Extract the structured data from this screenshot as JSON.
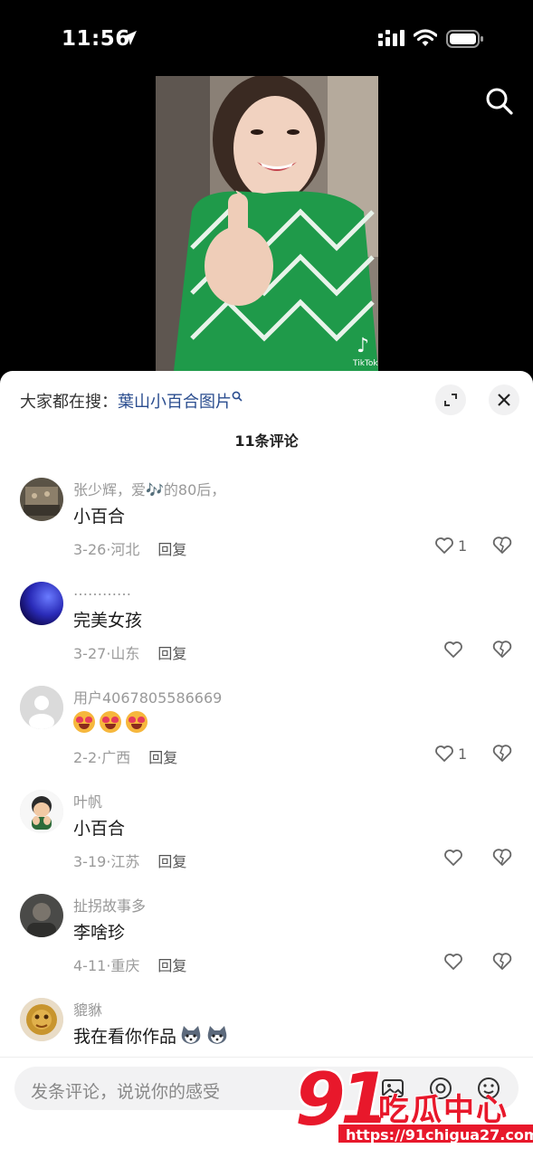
{
  "status_bar": {
    "time": "11:56"
  },
  "hot_search": {
    "prefix": "大家都在搜：",
    "query": "葉山小百合图片"
  },
  "comment_count": "11条评论",
  "comments": [
    {
      "user": "张少辉，爱🎶的80后，",
      "text": "小百合",
      "date_loc": "3-26·河北",
      "reply": "回复",
      "likes": "1"
    },
    {
      "user": "…………",
      "text": "完美女孩",
      "date_loc": "3-27·山东",
      "reply": "回复",
      "likes": ""
    },
    {
      "user": "用户4067805586669",
      "text": "",
      "date_loc": "2-2·广西",
      "reply": "回复",
      "likes": "1"
    },
    {
      "user": "叶帆",
      "text": "小百合",
      "date_loc": "3-19·江苏",
      "reply": "回复",
      "likes": ""
    },
    {
      "user": "扯拐故事多",
      "text": "李啥珍",
      "date_loc": "4-11·重庆",
      "reply": "回复",
      "likes": ""
    },
    {
      "user": "貔貅",
      "text": "我在看你作品",
      "date_loc": "",
      "reply": "",
      "likes": ""
    }
  ],
  "input": {
    "placeholder": "发条评论，说说你的感受"
  },
  "watermark": {
    "number": "91",
    "brand": "吃瓜中心",
    "url": "https://91chigua27.com"
  },
  "video": {
    "tiktok_label": "TikTok"
  }
}
